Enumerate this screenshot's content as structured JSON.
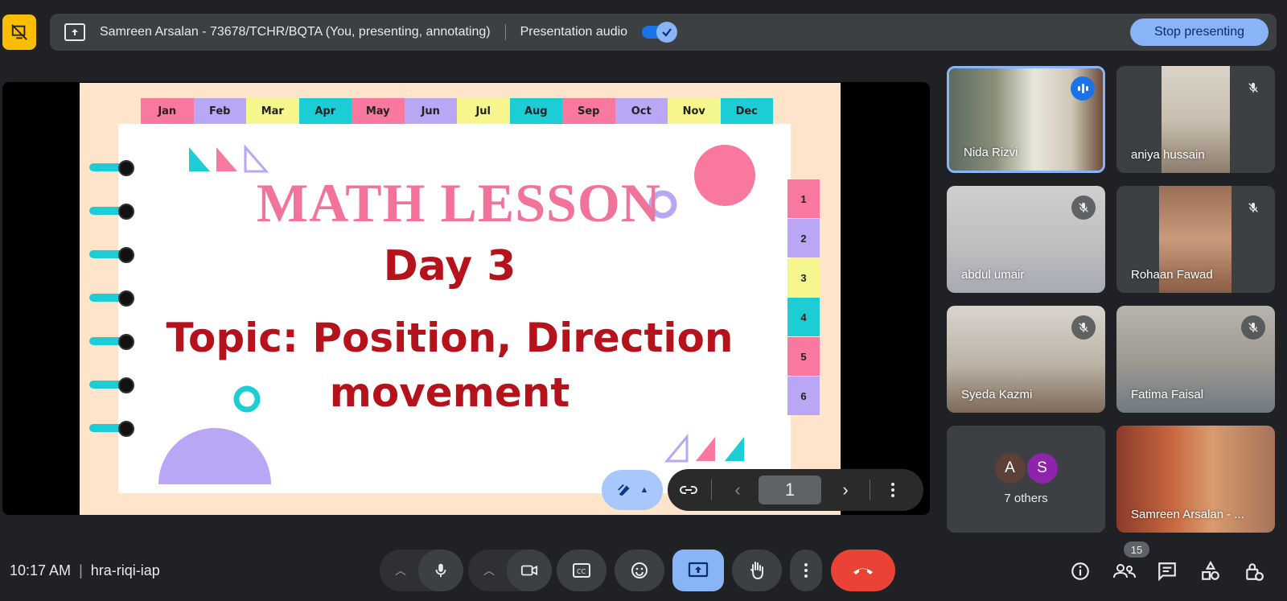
{
  "banner": {
    "presenter_text": "Samreen Arsalan - 73678/TCHR/BQTA (You, presenting, annotating)",
    "audio_label": "Presentation audio",
    "audio_enabled": true,
    "stop_label": "Stop presenting"
  },
  "slide": {
    "months": [
      "Jan",
      "Feb",
      "Mar",
      "Apr",
      "May",
      "Jun",
      "Jul",
      "Aug",
      "Sep",
      "Oct",
      "Nov",
      "Dec"
    ],
    "month_colors": [
      "#f9789f",
      "#b9a6f5",
      "#f5f78c",
      "#1dcdd6",
      "#f9789f",
      "#b9a6f5",
      "#f5f78c",
      "#1dcdd6",
      "#f9789f",
      "#b9a6f5",
      "#f5f78c",
      "#1dcdd6"
    ],
    "side_tabs": [
      "1",
      "2",
      "3",
      "4",
      "5",
      "6"
    ],
    "side_tab_colors": [
      "#f9789f",
      "#b9a6f5",
      "#f5f78c",
      "#1dcdd6",
      "#f9789f",
      "#b9a6f5"
    ],
    "title": "MATH LESSON",
    "day": "Day 3",
    "topic_line1": "Topic: Position, Direction",
    "topic_line2": "movement"
  },
  "slide_nav": {
    "page_number": "1"
  },
  "participants": [
    {
      "name": "Nida Rizvi",
      "speaking": true
    },
    {
      "name": "aniya hussain",
      "muted": true
    },
    {
      "name": "abdul umair",
      "muted": true
    },
    {
      "name": "Rohaan Fawad",
      "muted": true
    },
    {
      "name": "Syeda Kazmi",
      "muted": true
    },
    {
      "name": "Fatima Faisal",
      "muted": true
    },
    {
      "name": "Samreen Arsalan - ..."
    }
  ],
  "others": {
    "avatars": [
      "A",
      "S"
    ],
    "avatar_colors": [
      "#5d4037",
      "#8e24aa"
    ],
    "label": "7 others"
  },
  "bottom": {
    "time": "10:17 AM",
    "meeting_code": "hra-riqi-iap",
    "participant_count": "15"
  },
  "colors": {
    "accent": "#8ab4f8",
    "end_call": "#ea4335",
    "warning": "#fbbc04"
  }
}
